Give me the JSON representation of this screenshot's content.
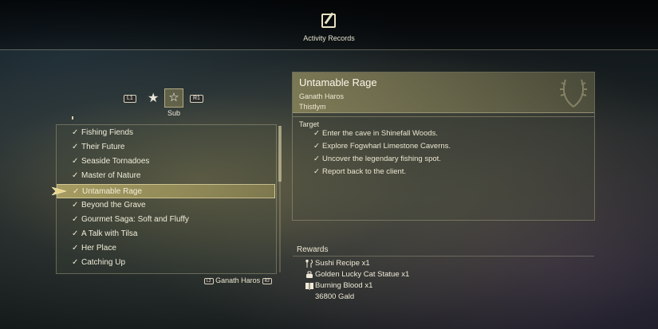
{
  "header": {
    "title": "Activity Records",
    "icon": "quill-page-icon"
  },
  "category_selector": {
    "prev_button": "L1",
    "next_button": "R1",
    "options": [
      {
        "icon": "star-filled-icon",
        "selected": false
      },
      {
        "icon": "star-outline-icon",
        "selected": true
      }
    ],
    "selected_label": "Sub"
  },
  "quest_list": {
    "items": [
      {
        "label": "Fishing Fiends",
        "completed": true
      },
      {
        "label": "Their Future",
        "completed": true
      },
      {
        "label": "Seaside Tornadoes",
        "completed": true
      },
      {
        "label": "Master of Nature",
        "completed": true
      },
      {
        "label": "Untamable Rage",
        "completed": true,
        "selected": true
      },
      {
        "label": "Beyond the Grave",
        "completed": true
      },
      {
        "label": "Gourmet Saga: Soft and Fluffy",
        "completed": true
      },
      {
        "label": "A Talk with Tilsa",
        "completed": true
      },
      {
        "label": "Her Place",
        "completed": true
      },
      {
        "label": "Catching Up",
        "completed": true
      }
    ],
    "checkmark": "✓",
    "filter": {
      "prev_button": "L2",
      "label": "Ganath Haros",
      "next_button": "R2"
    }
  },
  "detail": {
    "title": "Untamable Rage",
    "client": "Ganath Haros",
    "location": "Thistlym",
    "target_label": "Target",
    "objectives": [
      "Enter the cave in Shinefall Woods.",
      "Explore Fogwharl Limestone Caverns.",
      "Uncover the legendary fishing spot.",
      "Report back to the client."
    ]
  },
  "rewards": {
    "label": "Rewards",
    "items": [
      {
        "icon": "food-utensils-icon",
        "label": "Sushi Recipe x1"
      },
      {
        "icon": "valuable-item-icon",
        "label": "Golden Lucky Cat Statue x1"
      },
      {
        "icon": "book-icon",
        "label": "Burning Blood x1"
      },
      {
        "icon": "",
        "label": "36800 Gald"
      }
    ]
  },
  "colors": {
    "selection_gold": "#c8b96e",
    "text_cream": "#f1ecd8",
    "panel_border": "#d2c8a0"
  }
}
